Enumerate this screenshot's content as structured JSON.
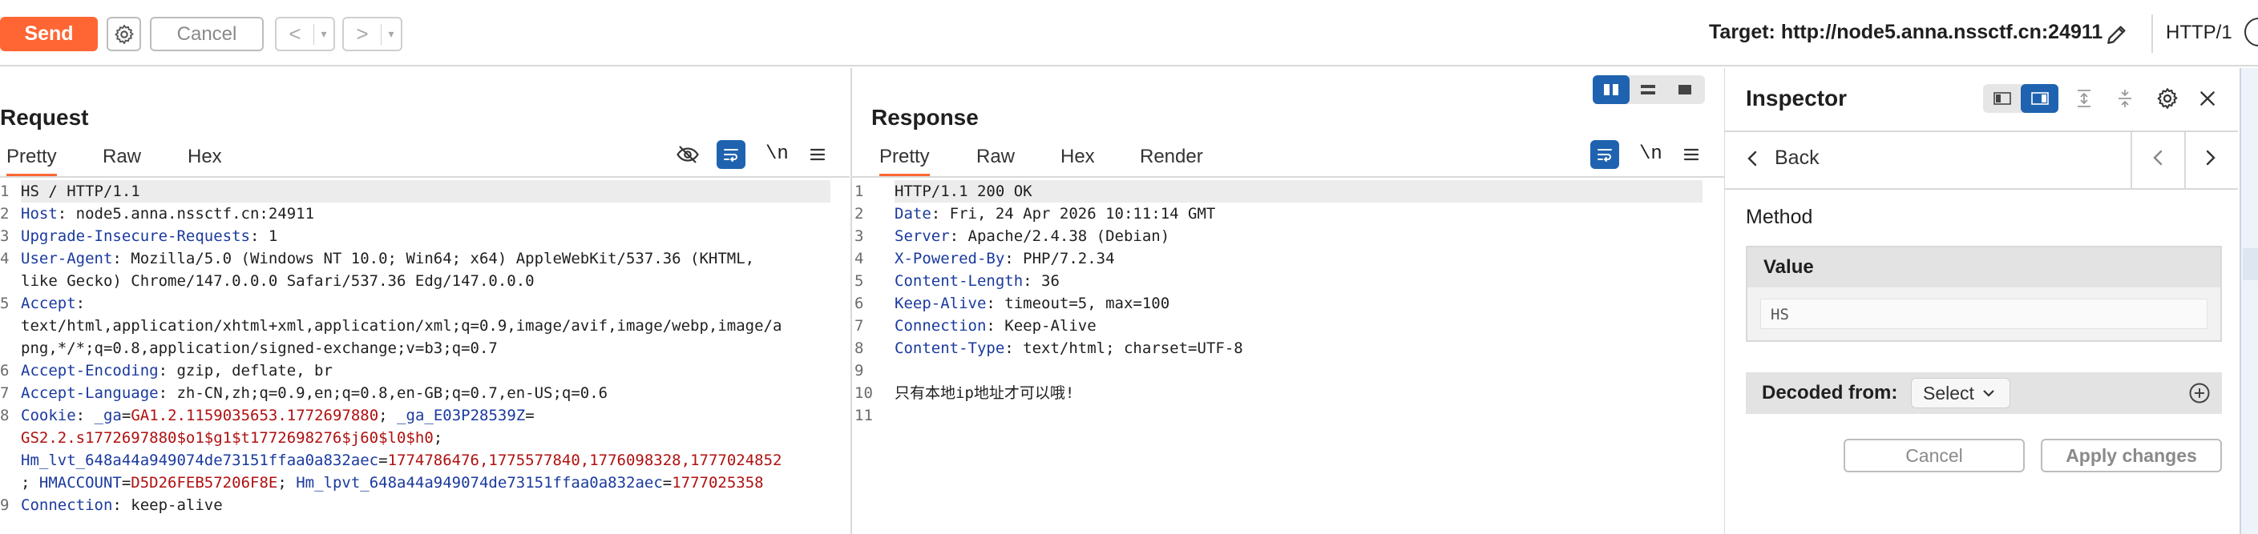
{
  "toolbar": {
    "send_label": "Send",
    "cancel_label": "Cancel",
    "back_arrow": "<",
    "forward_arrow": ">",
    "dropdown_glyph": "▾",
    "target_label": "Target: http://node5.anna.nssctf.cn:24911",
    "http_version": "HTTP/1"
  },
  "request": {
    "title": "Request",
    "tabs": [
      "Pretty",
      "Raw",
      "Hex"
    ],
    "active_tab": "Pretty",
    "newline_toggle": "\\n",
    "lines": [
      {
        "n": "1",
        "parts": [
          {
            "t": "HS / HTTP/1.1",
            "c": "plain"
          }
        ],
        "highlight": true
      },
      {
        "n": "2",
        "parts": [
          {
            "t": "Host",
            "c": "hname"
          },
          {
            "t": ": node5.anna.nssctf.cn:24911",
            "c": "plain"
          }
        ]
      },
      {
        "n": "3",
        "parts": [
          {
            "t": "Upgrade-Insecure-Requests",
            "c": "hname"
          },
          {
            "t": ": 1",
            "c": "plain"
          }
        ]
      },
      {
        "n": "4",
        "parts": [
          {
            "t": "User-Agent",
            "c": "hname"
          },
          {
            "t": ": Mozilla/5.0 (Windows NT 10.0; Win64; x64) AppleWebKit/537.36 (KHTML,",
            "c": "plain"
          }
        ]
      },
      {
        "n": "",
        "parts": [
          {
            "t": "like Gecko) Chrome/147.0.0.0 Safari/537.36 Edg/147.0.0.0",
            "c": "plain"
          }
        ]
      },
      {
        "n": "5",
        "parts": [
          {
            "t": "Accept",
            "c": "hname"
          },
          {
            "t": ":",
            "c": "plain"
          }
        ]
      },
      {
        "n": "",
        "parts": [
          {
            "t": "text/html,application/xhtml+xml,application/xml;q=0.9,image/avif,image/webp,image/a",
            "c": "plain"
          }
        ]
      },
      {
        "n": "",
        "parts": [
          {
            "t": "png,*/*;q=0.8,application/signed-exchange;v=b3;q=0.7",
            "c": "plain"
          }
        ]
      },
      {
        "n": "6",
        "parts": [
          {
            "t": "Accept-Encoding",
            "c": "hname"
          },
          {
            "t": ": gzip, deflate, br",
            "c": "plain"
          }
        ]
      },
      {
        "n": "7",
        "parts": [
          {
            "t": "Accept-Language",
            "c": "hname"
          },
          {
            "t": ": zh-CN,zh;q=0.9,en;q=0.8,en-GB;q=0.7,en-US;q=0.6",
            "c": "plain"
          }
        ]
      },
      {
        "n": "8",
        "parts": [
          {
            "t": "Cookie",
            "c": "hname"
          },
          {
            "t": ": ",
            "c": "plain"
          },
          {
            "t": "_ga",
            "c": "cname"
          },
          {
            "t": "=",
            "c": "plain"
          },
          {
            "t": "GA1.2.1159035653.1772697880",
            "c": "cval"
          },
          {
            "t": "; ",
            "c": "plain"
          },
          {
            "t": "_ga_E03P28539Z",
            "c": "cname"
          },
          {
            "t": "=",
            "c": "plain"
          }
        ]
      },
      {
        "n": "",
        "parts": [
          {
            "t": "GS2.2.s1772697880$o1$g1$t1772698276$j60$l0$h0",
            "c": "cval"
          },
          {
            "t": ";",
            "c": "plain"
          }
        ]
      },
      {
        "n": "",
        "parts": [
          {
            "t": "Hm_lvt_648a44a949074de73151ffaa0a832aec",
            "c": "cname"
          },
          {
            "t": "=",
            "c": "plain"
          },
          {
            "t": "1774786476,1775577840,1776098328,1777024852",
            "c": "cval"
          }
        ]
      },
      {
        "n": "",
        "parts": [
          {
            "t": "; ",
            "c": "plain"
          },
          {
            "t": "HMACCOUNT",
            "c": "cname"
          },
          {
            "t": "=",
            "c": "plain"
          },
          {
            "t": "D5D26FEB57206F8E",
            "c": "cval"
          },
          {
            "t": "; ",
            "c": "plain"
          },
          {
            "t": "Hm_lpvt_648a44a949074de73151ffaa0a832aec",
            "c": "cname"
          },
          {
            "t": "=",
            "c": "plain"
          },
          {
            "t": "1777025358",
            "c": "cval"
          }
        ]
      },
      {
        "n": "9",
        "parts": [
          {
            "t": "Connection",
            "c": "hname"
          },
          {
            "t": ": keep-alive",
            "c": "plain"
          }
        ]
      }
    ]
  },
  "response": {
    "title": "Response",
    "tabs": [
      "Pretty",
      "Raw",
      "Hex",
      "Render"
    ],
    "active_tab": "Pretty",
    "newline_toggle": "\\n",
    "lines": [
      {
        "n": "1",
        "parts": [
          {
            "t": "HTTP/1.1 200 OK",
            "c": "plain"
          }
        ],
        "highlight": true
      },
      {
        "n": "2",
        "parts": [
          {
            "t": "Date",
            "c": "hname"
          },
          {
            "t": ": Fri, 24 Apr 2026 10:11:14 GMT",
            "c": "plain"
          }
        ]
      },
      {
        "n": "3",
        "parts": [
          {
            "t": "Server",
            "c": "hname"
          },
          {
            "t": ": Apache/2.4.38 (Debian)",
            "c": "plain"
          }
        ]
      },
      {
        "n": "4",
        "parts": [
          {
            "t": "X-Powered-By",
            "c": "hname"
          },
          {
            "t": ": PHP/7.2.34",
            "c": "plain"
          }
        ]
      },
      {
        "n": "5",
        "parts": [
          {
            "t": "Content-Length",
            "c": "hname"
          },
          {
            "t": ": 36",
            "c": "plain"
          }
        ]
      },
      {
        "n": "6",
        "parts": [
          {
            "t": "Keep-Alive",
            "c": "hname"
          },
          {
            "t": ": timeout=5, max=100",
            "c": "plain"
          }
        ]
      },
      {
        "n": "7",
        "parts": [
          {
            "t": "Connection",
            "c": "hname"
          },
          {
            "t": ": Keep-Alive",
            "c": "plain"
          }
        ]
      },
      {
        "n": "8",
        "parts": [
          {
            "t": "Content-Type",
            "c": "hname"
          },
          {
            "t": ": text/html; charset=UTF-8",
            "c": "plain"
          }
        ]
      },
      {
        "n": "9",
        "parts": [
          {
            "t": "",
            "c": "plain"
          }
        ]
      },
      {
        "n": "10",
        "parts": [
          {
            "t": "只有本地ip地址才可以哦!",
            "c": "plain"
          }
        ]
      },
      {
        "n": "11",
        "parts": [
          {
            "t": "",
            "c": "plain"
          }
        ]
      }
    ]
  },
  "inspector": {
    "title": "Inspector",
    "back_label": "Back",
    "method_label": "Method",
    "value_header": "Value",
    "value": "HS",
    "decoded_label": "Decoded from:",
    "decoded_select": "Select",
    "cancel_label": "Cancel",
    "apply_label": "Apply changes"
  },
  "colors": {
    "accent": "#ff6633",
    "toggle_blue": "#1f63b0",
    "header_name": "#1a3a9e",
    "cookie_value": "#b01010"
  }
}
